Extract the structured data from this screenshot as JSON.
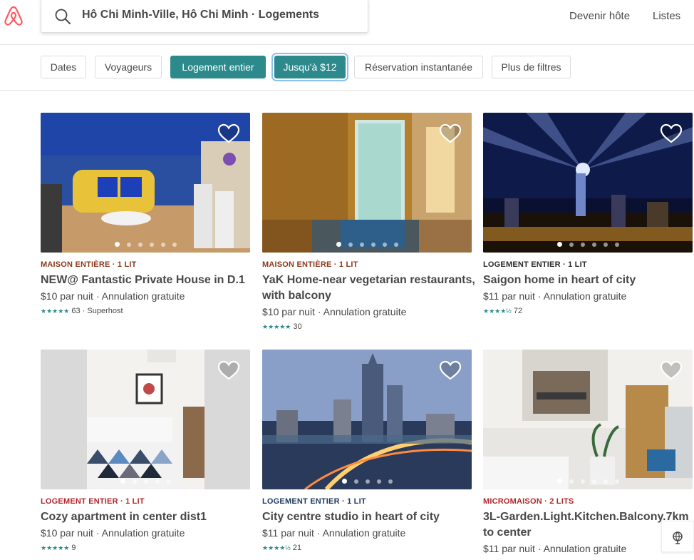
{
  "header": {
    "search_query": "Hô Chi Minh-Ville, Hô Chi Minh · Logements",
    "host_link": "Devenir hôte",
    "lists_link": "Listes",
    "brand_color": "#ff5a5f"
  },
  "filters": [
    {
      "label": "Dates"
    },
    {
      "label": "Voyageurs"
    },
    {
      "label": "Logement entier"
    },
    {
      "label": "Jusqu'à $12"
    },
    {
      "label": "Réservation instantanée"
    },
    {
      "label": "Plus de filtres"
    }
  ],
  "accent_color": "#2c8a8c",
  "listings": [
    {
      "kicker": "MAISON ENTIÈRE · 1 LIT",
      "kicker_color": "#8a3b1e",
      "title": "NEW@ Fantastic Private House in D.1",
      "price": "$10  par nuit · Annulation gratuite",
      "stars": "★★★★★",
      "rating_text": "63 · Superhost"
    },
    {
      "kicker": "MAISON ENTIÈRE · 1 LIT",
      "kicker_color": "#8a3b1e",
      "title": "YaK Home-near vegetarian restaurants, with balcony",
      "price": "$10  par nuit · Annulation gratuite",
      "stars": "★★★★★",
      "rating_text": "30"
    },
    {
      "kicker": "LOGEMENT ENTIER · 1 LIT",
      "kicker_color": "#2a2a2a",
      "title": "Saigon home in heart of city",
      "price": "$11  par nuit · Annulation gratuite",
      "stars": "★★★★½",
      "rating_text": "72"
    },
    {
      "kicker": "LOGEMENT ENTIER · 1 LIT",
      "kicker_color": "#b0282e",
      "title": "Cozy apartment in center dist1",
      "price": "$10  par nuit · Annulation gratuite",
      "stars": "★★★★★",
      "rating_text": "9"
    },
    {
      "kicker": "LOGEMENT ENTIER · 1 LIT",
      "kicker_color": "#1e3a5c",
      "title": "City centre studio in heart of city",
      "price": "$11  par nuit · Annulation gratuite",
      "stars": "★★★★½",
      "rating_text": "21"
    },
    {
      "kicker": "MICROMAISON · 2 LITS",
      "kicker_color": "#b0282e",
      "title": "3L-Garden.Light.Kitchen.Balcony.7km to center",
      "price": "$11  par nuit · Annulation gratuite",
      "stars": "",
      "rating_text": ""
    }
  ]
}
